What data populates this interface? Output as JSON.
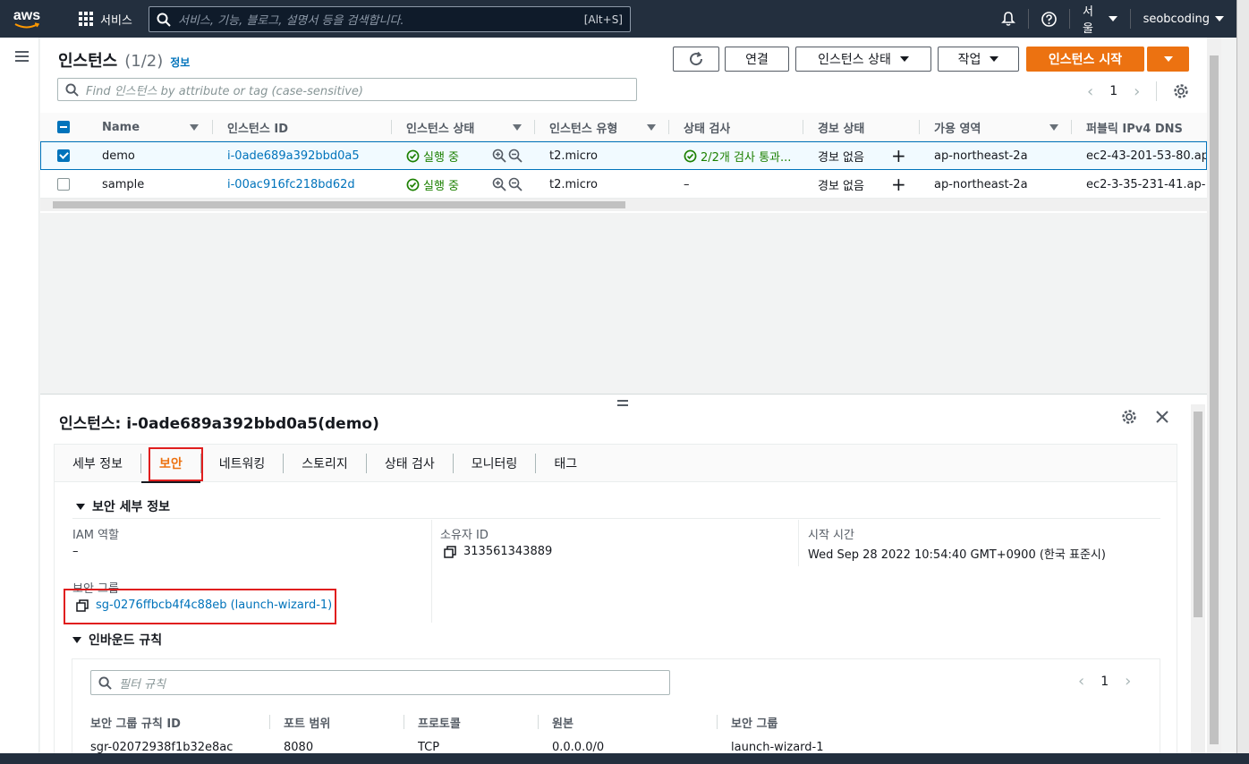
{
  "nav": {
    "logo": "aws",
    "services": "서비스",
    "search_placeholder": "서비스, 기능, 블로그, 설명서 등을 검색합니다.",
    "search_shortcut": "[Alt+S]",
    "region": "서울",
    "user": "seobcoding"
  },
  "instances": {
    "title": "인스턴스",
    "count": "(1/2)",
    "info": "정보",
    "buttons": {
      "connect": "연결",
      "state": "인스턴스 상태",
      "actions": "작업",
      "launch": "인스턴스 시작"
    },
    "find_placeholder": "Find 인스턴스 by attribute or tag (case-sensitive)",
    "page": "1",
    "columns": [
      "Name",
      "인스턴스 ID",
      "인스턴스 상태",
      "인스턴스 유형",
      "상태 검사",
      "경보 상태",
      "가용 영역",
      "퍼블릭 IPv4 DNS"
    ],
    "rows": [
      {
        "name": "demo",
        "id": "i-0ade689a392bbd0a5",
        "state": "실행 중",
        "type": "t2.micro",
        "check": "2/2개 검사 통과...",
        "alarm": "경보 없음",
        "az": "ap-northeast-2a",
        "dns": "ec2-43-201-53-80.ap-"
      },
      {
        "name": "sample",
        "id": "i-00ac916fc218bd62d",
        "state": "실행 중",
        "type": "t2.micro",
        "check": "–",
        "alarm": "경보 없음",
        "az": "ap-northeast-2a",
        "dns": "ec2-3-35-231-41.ap-"
      }
    ]
  },
  "detail": {
    "title": "인스턴스: i-0ade689a392bbd0a5(demo)",
    "tabs": [
      "세부 정보",
      "보안",
      "네트워킹",
      "스토리지",
      "상태 검사",
      "모니터링",
      "태그"
    ],
    "security_section": "보안 세부 정보",
    "iam_label": "IAM 역할",
    "iam_value": "–",
    "owner_label": "소유자 ID",
    "owner_value": "313561343889",
    "launch_label": "시작 시간",
    "launch_value": "Wed Sep 28 2022 10:54:40 GMT+0900 (한국 표준시)",
    "sg_label": "보안 그룹",
    "sg_value": "sg-0276ffbcb4f4c88eb (launch-wizard-1)",
    "inbound_section": "인바운드 규칙",
    "filter_placeholder": "필터 규칙",
    "page": "1",
    "rule_columns": [
      "보안 그룹 규칙 ID",
      "포트 범위",
      "프로토콜",
      "원본",
      "보안 그룹"
    ],
    "rule_row": [
      "sgr-02072938f1b32e8ac",
      "8080",
      "TCP",
      "0.0.0.0/0",
      "launch-wizard-1"
    ]
  },
  "colors": {
    "accent": "#ec7211",
    "link": "#0073bb",
    "nav": "#232f3e",
    "success": "#1d8102",
    "highlight": "#e01e1e"
  }
}
